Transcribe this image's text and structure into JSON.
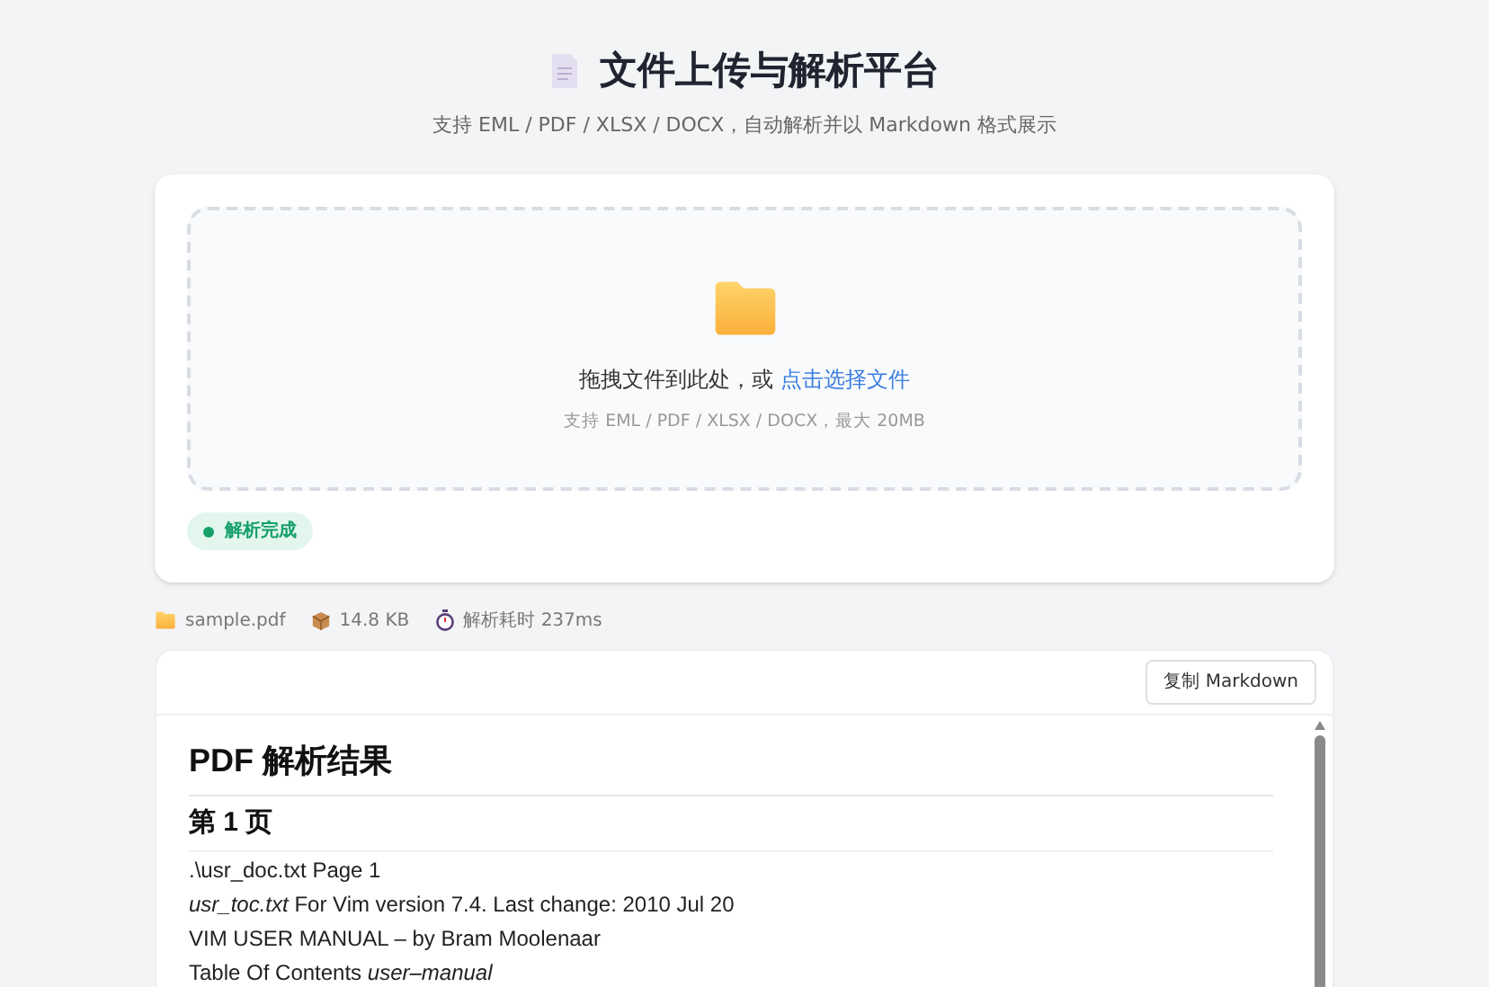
{
  "header": {
    "title": "文件上传与解析平台",
    "subtitle": "支持 EML / PDF / XLSX / DOCX，自动解析并以 Markdown 格式展示"
  },
  "dropzone": {
    "prompt": "拖拽文件到此处，或",
    "link": "点击选择文件",
    "hint": "支持 EML / PDF / XLSX / DOCX，最大 20MB"
  },
  "status": {
    "label": "解析完成",
    "kind": "success"
  },
  "file_info": [
    {
      "kind": "file",
      "text": "sample.pdf"
    },
    {
      "kind": "size",
      "text": "14.8 KB"
    },
    {
      "kind": "time",
      "text": "解析耗时 237ms"
    }
  ],
  "result": {
    "copy_button": "复制 Markdown",
    "content": [
      {
        "kind": "h1",
        "text": "PDF 解析结果"
      },
      {
        "kind": "h2",
        "text": "第 1 页"
      },
      {
        "kind": "p",
        "text": ".\\usr_doc.txt Page 1"
      },
      {
        "kind": "p",
        "text": "*usr_toc.txt* For Vim version 7.4. Last change: 2010 Jul 20"
      },
      {
        "kind": "p",
        "text": "VIM USER MANUAL – by Bram Moolenaar"
      },
      {
        "kind": "p",
        "text": "Table Of Contents *user–manual*"
      }
    ]
  }
}
